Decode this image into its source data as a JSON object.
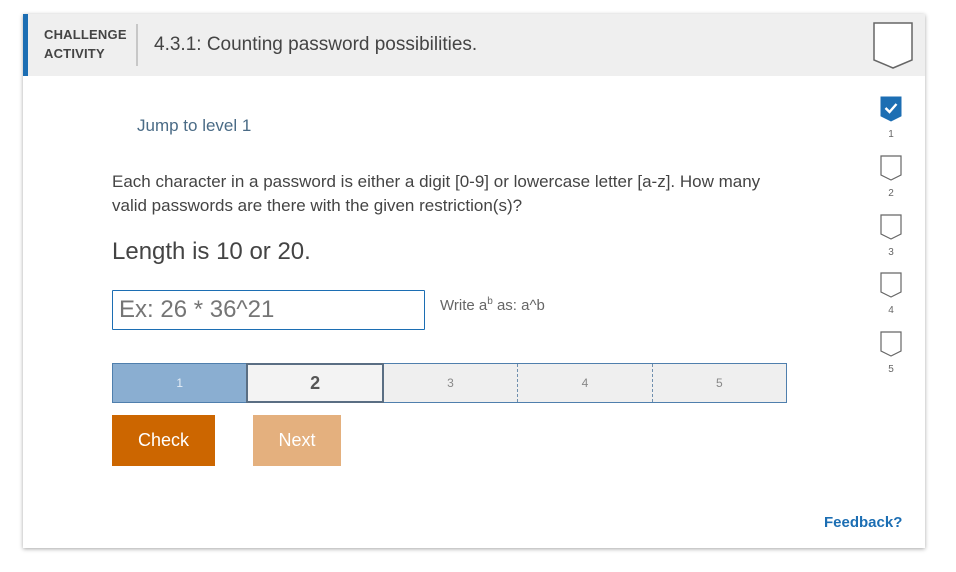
{
  "header": {
    "label_line1": "CHALLENGE",
    "label_line2": "ACTIVITY",
    "title": "4.3.1: Counting password possibilities."
  },
  "jump_link": "Jump to level 1",
  "question": "Each character in a password is either a digit [0-9] or lowercase letter [a-z]. How many valid passwords are there with the given restriction(s)?",
  "restriction": "Length is 10 or 20.",
  "answer": {
    "value": "",
    "placeholder": "Ex: 26 * 36^21"
  },
  "hint": {
    "prefix": "Write a",
    "superscript": "b",
    "suffix": " as: a^b"
  },
  "levels": [
    {
      "label": "1",
      "state": "done"
    },
    {
      "label": "2",
      "state": "current"
    },
    {
      "label": "3",
      "state": "pending"
    },
    {
      "label": "4",
      "state": "pending"
    },
    {
      "label": "5",
      "state": "pending"
    }
  ],
  "buttons": {
    "check": "Check",
    "next": "Next"
  },
  "feedback": "Feedback?",
  "progress": [
    {
      "num": "1",
      "completed": true
    },
    {
      "num": "2",
      "completed": false
    },
    {
      "num": "3",
      "completed": false
    },
    {
      "num": "4",
      "completed": false
    },
    {
      "num": "5",
      "completed": false
    }
  ],
  "colors": {
    "accent": "#1c6eb3",
    "check_button": "#cc6600",
    "next_button": "#e4b07e",
    "level_done": "#8aaed1"
  },
  "icons": {
    "header_badge": "shield-outline-icon",
    "progress_done": "checkmark-shield-icon",
    "progress_pending": "shield-outline-icon"
  }
}
